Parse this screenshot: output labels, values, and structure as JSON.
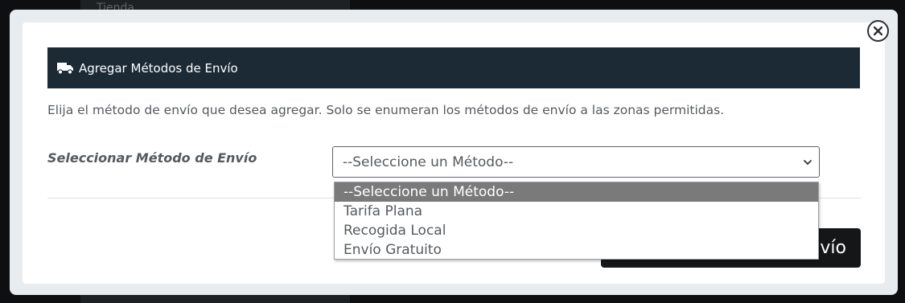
{
  "background": {
    "panel_text": "Tienda"
  },
  "modal": {
    "header_title": "Agregar Métodos de Envío",
    "description": "Elija el método de envío que desea agregar. Solo se enumeran los métodos de envío a las zonas permitidas.",
    "field_label": "Seleccionar Método de Envío",
    "select": {
      "selected_value": "--Seleccione un Método--",
      "options": [
        "--Seleccione un Método--",
        "Tarifa Plana",
        "Recogida Local",
        "Envío Gratuito"
      ],
      "highlighted_index": 0
    },
    "submit_label_visible": "vío"
  },
  "colors": {
    "header_bg": "#1c2a36",
    "selected_option_bg": "#7a7a7a",
    "button_bg": "#141618"
  },
  "icons": {
    "header": "truck-icon",
    "close": "close-icon",
    "select": "chevron-down-icon"
  }
}
